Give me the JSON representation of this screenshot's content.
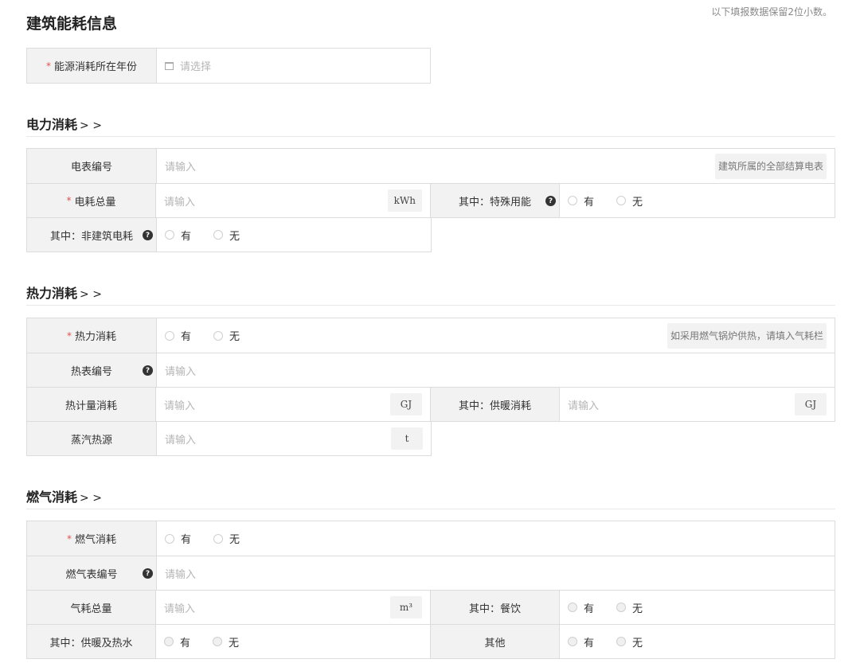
{
  "page": {
    "title": "建筑能耗信息",
    "note": "以下填报数据保留2位小数。"
  },
  "year": {
    "label": "能源消耗所在年份",
    "placeholder": "请选择"
  },
  "common": {
    "required_mark": "*",
    "input_placeholder": "请输入",
    "yes": "有",
    "no": "无",
    "section_suffix": "> >",
    "help_glyph": "?"
  },
  "electric": {
    "title": "电力消耗",
    "meter_label": "电表编号",
    "meter_hint": "建筑所属的全部结算电表",
    "total_label": "电耗总量",
    "total_unit": "kWh",
    "special_label": "其中：特殊用能",
    "non_building_label": "其中：非建筑电耗"
  },
  "heat": {
    "title": "热力消耗",
    "consumption_label": "热力消耗",
    "consumption_hint": "如采用燃气锅炉供热，请填入气耗栏",
    "meter_label": "热表编号",
    "metered_label": "热计量消耗",
    "metered_unit": "GJ",
    "heating_label": "其中：供暖消耗",
    "heating_unit": "GJ",
    "steam_label": "蒸汽热源",
    "steam_unit": "t"
  },
  "gas": {
    "title": "燃气消耗",
    "consumption_label": "燃气消耗",
    "meter_label": "燃气表编号",
    "total_label": "气耗总量",
    "total_unit": "m³",
    "catering_label": "其中：餐饮",
    "heating_water_label": "其中：供暖及热水",
    "other_label": "其他"
  }
}
